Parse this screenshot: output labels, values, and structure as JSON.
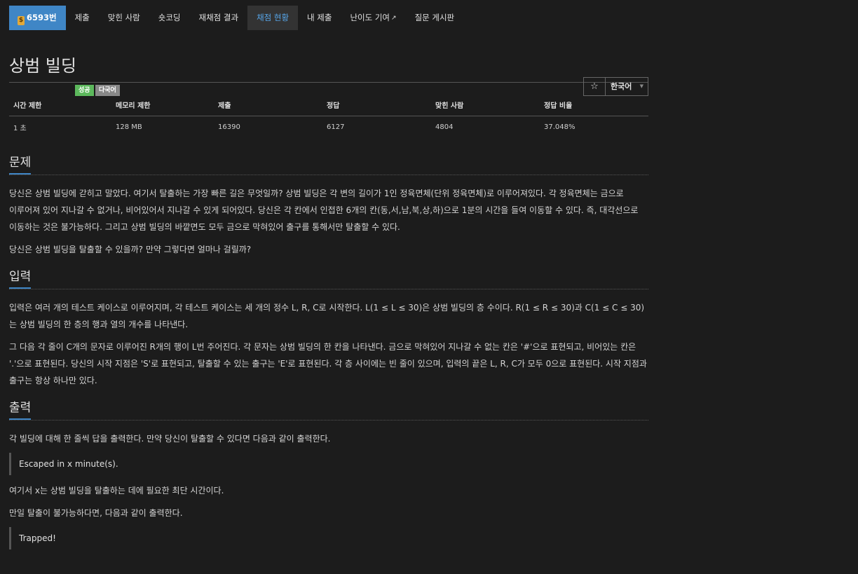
{
  "nav": {
    "problem_number": "6593번",
    "tabs": [
      "제출",
      "맞힌 사람",
      "숏코딩",
      "재채점 결과",
      "채점 현황",
      "내 제출",
      "난이도 기여",
      "질문 게시판"
    ]
  },
  "title": "상범 빌딩",
  "badges": {
    "success": "성공",
    "multilang": "다국어"
  },
  "buttons": {
    "star": "☆",
    "language": "한국어"
  },
  "stats": {
    "headers": [
      "시간 제한",
      "메모리 제한",
      "제출",
      "정답",
      "맞힌 사람",
      "정답 비율"
    ],
    "values": [
      "1 초",
      "128 MB",
      "16390",
      "6127",
      "4804",
      "37.048%"
    ]
  },
  "sections": {
    "problem": {
      "heading": "문제",
      "p1": "당신은 상범 빌딩에 갇히고 말았다. 여기서 탈출하는 가장 빠른 길은 무엇일까? 상범 빌딩은 각 변의 길이가 1인 정육면체(단위 정육면체)로 이루어져있다. 각 정육면체는 금으로 이루어져 있어 지나갈 수 없거나, 비어있어서 지나갈 수 있게 되어있다. 당신은 각 칸에서 인접한 6개의 칸(동,서,남,북,상,하)으로 1분의 시간을 들여 이동할 수 있다. 즉, 대각선으로 이동하는 것은 불가능하다. 그리고 상범 빌딩의 바깥면도 모두 금으로 막혀있어 출구를 통해서만 탈출할 수 있다.",
      "p2": "당신은 상범 빌딩을 탈출할 수 있을까? 만약 그렇다면 얼마나 걸릴까?"
    },
    "input": {
      "heading": "입력",
      "p1": "입력은 여러 개의 테스트 케이스로 이루어지며, 각 테스트 케이스는 세 개의 정수 L, R, C로 시작한다. L(1 ≤ L ≤ 30)은 상범 빌딩의 층 수이다. R(1 ≤ R ≤ 30)과 C(1 ≤ C ≤ 30)는 상범 빌딩의 한 층의 행과 열의 개수를 나타낸다.",
      "p2": "그 다음 각 줄이 C개의 문자로 이루어진 R개의 행이 L번 주어진다. 각 문자는 상범 빌딩의 한 칸을 나타낸다. 금으로 막혀있어 지나갈 수 없는 칸은 '#'으로 표현되고, 비어있는 칸은 '.'으로 표현된다. 당신의 시작 지점은 'S'로 표현되고, 탈출할 수 있는 출구는 'E'로 표현된다. 각 층 사이에는 빈 줄이 있으며, 입력의 끝은 L, R, C가 모두 0으로 표현된다. 시작 지점과 출구는 항상 하나만 있다."
    },
    "output": {
      "heading": "출력",
      "p1": "각 빌딩에 대해 한 줄씩 답을 출력한다. 만약 당신이 탈출할 수 있다면 다음과 같이 출력한다.",
      "sample1": "Escaped in x minute(s).",
      "p2": "여기서 x는 상범 빌딩을 탈출하는 데에 필요한 최단 시간이다.",
      "p3": "만일 탈출이 불가능하다면, 다음과 같이 출력한다.",
      "sample2": "Trapped!"
    }
  }
}
